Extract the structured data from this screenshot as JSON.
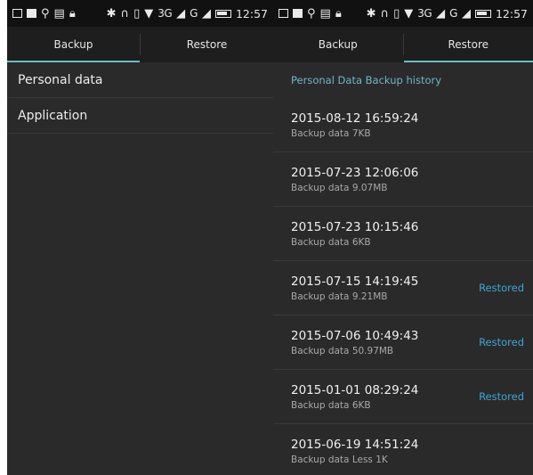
{
  "status_bar": {
    "network": "3G",
    "network2": "G",
    "time_left": "12:57",
    "time_right": "12:57"
  },
  "tabs": {
    "backup": "Backup",
    "restore": "Restore"
  },
  "left_panel": {
    "items": [
      "Personal data",
      "Application"
    ]
  },
  "right_panel": {
    "header": "Personal Data Backup history",
    "items": [
      {
        "date": "2015-08-12  16:59:24",
        "size": "Backup data 7KB",
        "status": ""
      },
      {
        "date": "2015-07-23  12:06:06",
        "size": "Backup data 9.07MB",
        "status": ""
      },
      {
        "date": "2015-07-23  10:15:46",
        "size": "Backup data 6KB",
        "status": ""
      },
      {
        "date": "2015-07-15  14:19:45",
        "size": "Backup data 9.21MB",
        "status": "Restored"
      },
      {
        "date": "2015-07-06  10:49:43",
        "size": "Backup data 50.97MB",
        "status": "Restored"
      },
      {
        "date": "2015-01-01  08:29:24",
        "size": "Backup data 6KB",
        "status": "Restored"
      },
      {
        "date": "2015-06-19  14:51:24",
        "size": "Backup data Less 1K",
        "status": ""
      }
    ]
  },
  "colors": {
    "accent_tab": "#62c0c4",
    "restored": "#3aa6d8",
    "background": "#2a2a2a"
  }
}
